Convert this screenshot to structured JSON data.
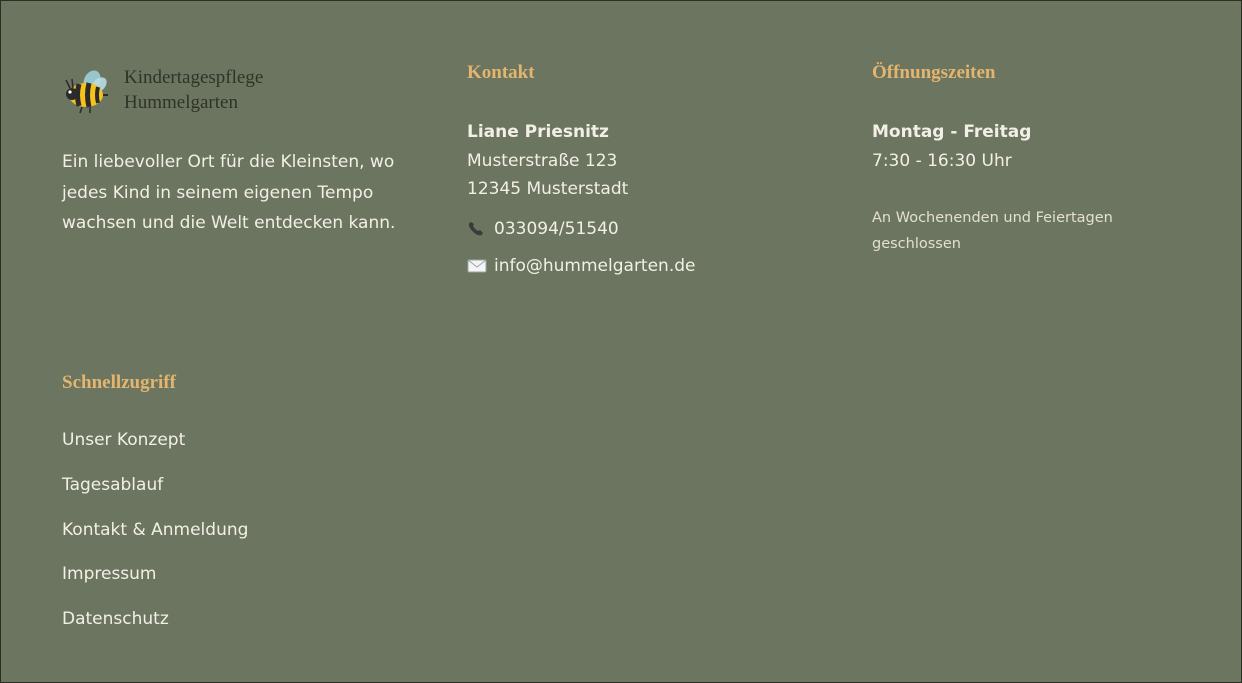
{
  "brand": {
    "line1": "Kindertagespflege",
    "line2": "Hummelgarten",
    "logo_icon": "bee-icon"
  },
  "about": {
    "text": "Ein liebevoller Ort für die Kleinsten, wo jedes Kind in seinem eigenen Tempo wachsen und die Welt entdecken kann."
  },
  "contact": {
    "heading": "Kontakt",
    "name": "Liane Priesnitz",
    "street": "Musterstraße 123",
    "city": "12345 Musterstadt",
    "phone": "033094/51540",
    "email": "info@hummelgarten.de",
    "phone_icon": "phone-icon",
    "email_icon": "envelope-icon"
  },
  "hours": {
    "heading": "Öffnungszeiten",
    "days": "Montag - Freitag",
    "time": "7:30 - 16:30 Uhr",
    "note": "An Wochenenden und Feiertagen geschlossen"
  },
  "quicklinks": {
    "heading": "Schnellzugriff",
    "items": [
      {
        "label": "Unser Konzept"
      },
      {
        "label": "Tagesablauf"
      },
      {
        "label": "Kontakt & Anmeldung"
      },
      {
        "label": "Impressum"
      },
      {
        "label": "Datenschutz"
      }
    ]
  },
  "colors": {
    "background": "#6c7560",
    "accent": "#e3b56f",
    "text": "#f2f0e6",
    "brand_text": "#2f3328"
  }
}
